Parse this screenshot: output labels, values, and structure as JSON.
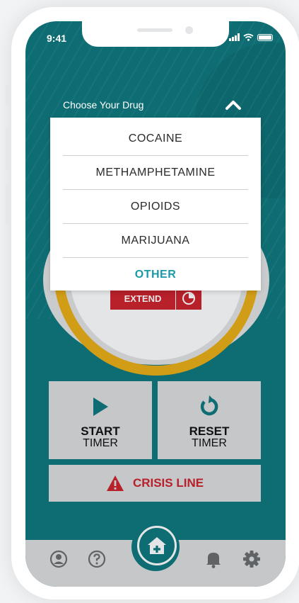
{
  "status_bar": {
    "time": "9:41"
  },
  "header": {
    "choose_label": "Choose Your Drug"
  },
  "dropdown": {
    "options": [
      "COCAINE",
      "METHAMPHETAMINE",
      "OPIOIDS",
      "MARIJUANA",
      "OTHER"
    ],
    "highlighted": "OTHER"
  },
  "timer": {
    "extend_label": "EXTEND"
  },
  "actions": {
    "start": {
      "line1": "START",
      "line2": "TIMER"
    },
    "reset": {
      "line1": "RESET",
      "line2": "TIMER"
    },
    "crisis_label": "CRISIS LINE"
  },
  "nav": {
    "icons": [
      "profile-icon",
      "help-icon",
      "home-icon",
      "bell-icon",
      "gear-icon"
    ]
  },
  "colors": {
    "teal": "#0d6d72",
    "accent_teal": "#1a9aa8",
    "danger_red": "#b8202a",
    "timer_gold": "#d19c16",
    "tile_gray": "#c5c7c9"
  }
}
